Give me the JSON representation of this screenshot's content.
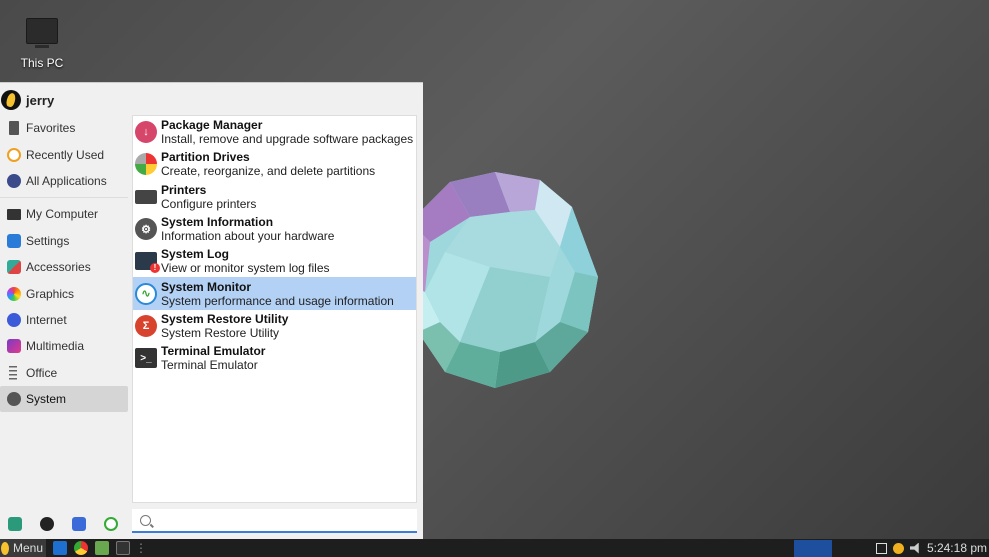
{
  "desktop": {
    "icon_label": "This PC"
  },
  "user": {
    "name": "jerry"
  },
  "sidebar": {
    "items": [
      {
        "label": "Favorites",
        "icon": "bookmark-icon"
      },
      {
        "label": "Recently Used",
        "icon": "clock-icon"
      },
      {
        "label": "All Applications",
        "icon": "apps-icon"
      },
      {
        "label": "My Computer",
        "icon": "monitor-icon"
      },
      {
        "label": "Settings",
        "icon": "settings-icon"
      },
      {
        "label": "Accessories",
        "icon": "accessories-icon"
      },
      {
        "label": "Graphics",
        "icon": "graphics-icon"
      },
      {
        "label": "Internet",
        "icon": "globe-icon"
      },
      {
        "label": "Multimedia",
        "icon": "multimedia-icon"
      },
      {
        "label": "Office",
        "icon": "document-icon"
      },
      {
        "label": "System",
        "icon": "gear-icon"
      }
    ],
    "active": "System"
  },
  "apps": [
    {
      "title": "Package Manager",
      "desc": "Install, remove and upgrade software packages"
    },
    {
      "title": "Partition Drives",
      "desc": "Create, reorganize, and delete partitions"
    },
    {
      "title": "Printers",
      "desc": "Configure printers"
    },
    {
      "title": "System Information",
      "desc": "Information about your hardware"
    },
    {
      "title": "System Log",
      "desc": "View or monitor system log files"
    },
    {
      "title": "System Monitor",
      "desc": "System performance and usage information"
    },
    {
      "title": "System Restore Utility",
      "desc": "System Restore Utility"
    },
    {
      "title": "Terminal Emulator",
      "desc": "Terminal Emulator"
    }
  ],
  "selected_app": "System Monitor",
  "search": {
    "value": "",
    "placeholder": ""
  },
  "taskbar": {
    "menu_label": "Menu",
    "separator": "⋮",
    "clock": "5:24:18 pm"
  },
  "colors": {
    "accent": "#3b7dd8",
    "selection": "#b3d1f5",
    "taskbar": "#1e1e1e"
  }
}
